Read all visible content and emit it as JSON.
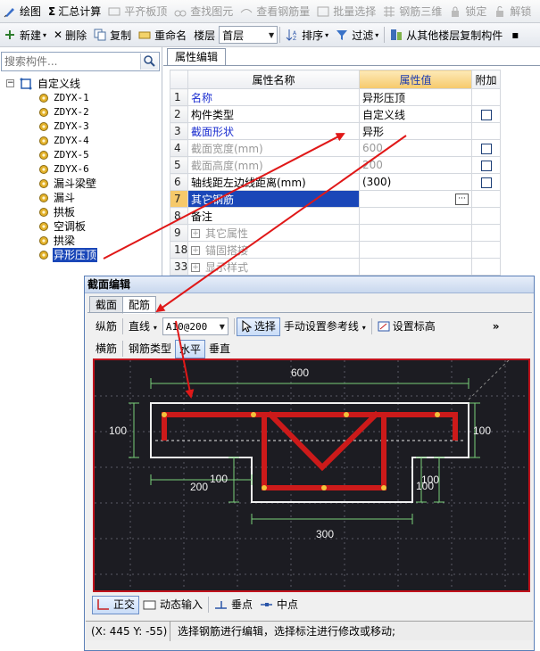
{
  "toolbar1": {
    "draw": "绘图",
    "sum": "汇总计算",
    "level_board": "平齐板顶",
    "find_element": "查找图元",
    "view_rebar": "查看钢筋量",
    "batch_select": "批量选择",
    "rebar_3d": "钢筋三维",
    "lock": "锁定",
    "unlock": "解锁"
  },
  "toolbar2": {
    "new": "新建",
    "delete": "删除",
    "copy": "复制",
    "rename": "重命名",
    "floor_label": "楼层",
    "floor_value": "首层",
    "sort": "排序",
    "filter": "过滤",
    "copy_from_other_floor": "从其他楼层复制构件"
  },
  "left_panel": {
    "search_placeholder": "搜索构件...",
    "root_label": "自定义线",
    "items": [
      "ZDYX-1",
      "ZDYX-2",
      "ZDYX-3",
      "ZDYX-4",
      "ZDYX-5",
      "ZDYX-6",
      "漏斗梁壁",
      "漏斗",
      "拱板",
      "空调板",
      "拱梁",
      "异形压顶"
    ],
    "selected": "异形压顶"
  },
  "properties": {
    "tab": "属性编辑",
    "headers": {
      "name": "属性名称",
      "value": "属性值",
      "extra": "附加"
    },
    "rows": [
      {
        "num": "1",
        "name": "名称",
        "value": "异形压顶",
        "checkbox": false,
        "style": "blue"
      },
      {
        "num": "2",
        "name": "构件类型",
        "value": "自定义线",
        "checkbox": true,
        "style": ""
      },
      {
        "num": "3",
        "name": "截面形状",
        "value": "异形",
        "checkbox": false,
        "style": "blue"
      },
      {
        "num": "4",
        "name": "截面宽度(mm)",
        "value": "600",
        "checkbox": true,
        "style": "gray"
      },
      {
        "num": "5",
        "name": "截面高度(mm)",
        "value": "200",
        "checkbox": true,
        "style": "gray"
      },
      {
        "num": "6",
        "name": "轴线距左边线距离(mm)",
        "value": "(300)",
        "checkbox": true,
        "style": ""
      },
      {
        "num": "7",
        "name": "其它钢筋",
        "value": "",
        "checkbox": false,
        "style": "selected"
      },
      {
        "num": "8",
        "name": "备注",
        "value": "",
        "checkbox": false,
        "style": ""
      },
      {
        "num": "9",
        "name": "其它属性",
        "value": "",
        "checkbox": false,
        "style": "group"
      },
      {
        "num": "18",
        "name": "锚固搭接",
        "value": "",
        "checkbox": false,
        "style": "group"
      },
      {
        "num": "33",
        "name": "显示样式",
        "value": "",
        "checkbox": false,
        "style": "group"
      }
    ],
    "ellipsis": "···"
  },
  "dialog": {
    "title": "截面编辑",
    "tabs": [
      "截面",
      "配筋"
    ],
    "active_tab": "配筋",
    "row1": {
      "longitudinal": "纵筋",
      "line_type": "直线",
      "rebar_spec": "A10@200",
      "select": "选择",
      "manual_ref": "手动设置参考线",
      "set_elevation": "设置标高",
      "more": "»"
    },
    "row2": {
      "transverse": "横筋",
      "rebar_type": "钢筋类型",
      "horizontal": "水平",
      "vertical": "垂直"
    },
    "canvas": {
      "dims": {
        "top": "600",
        "left": "100",
        "right": "100",
        "bottom": "300",
        "step_left": "200",
        "step_mid": "100",
        "step_right1": "100",
        "step_right2": "100"
      }
    },
    "bottom": {
      "ortho": "正交",
      "dynamic_input": "动态输入",
      "perpendicular": "垂点",
      "midpoint": "中点"
    },
    "status": {
      "coord": "(X: 445 Y: -55)",
      "message": "选择钢筋进行编辑，选择标注进行修改或移动;"
    }
  },
  "colors": {
    "selection": "#1a47b8",
    "rebar": "#cc1a1a",
    "arrow": "#e01818",
    "canvas_bg": "#1c1c22",
    "highlight": "#f6c96a"
  }
}
